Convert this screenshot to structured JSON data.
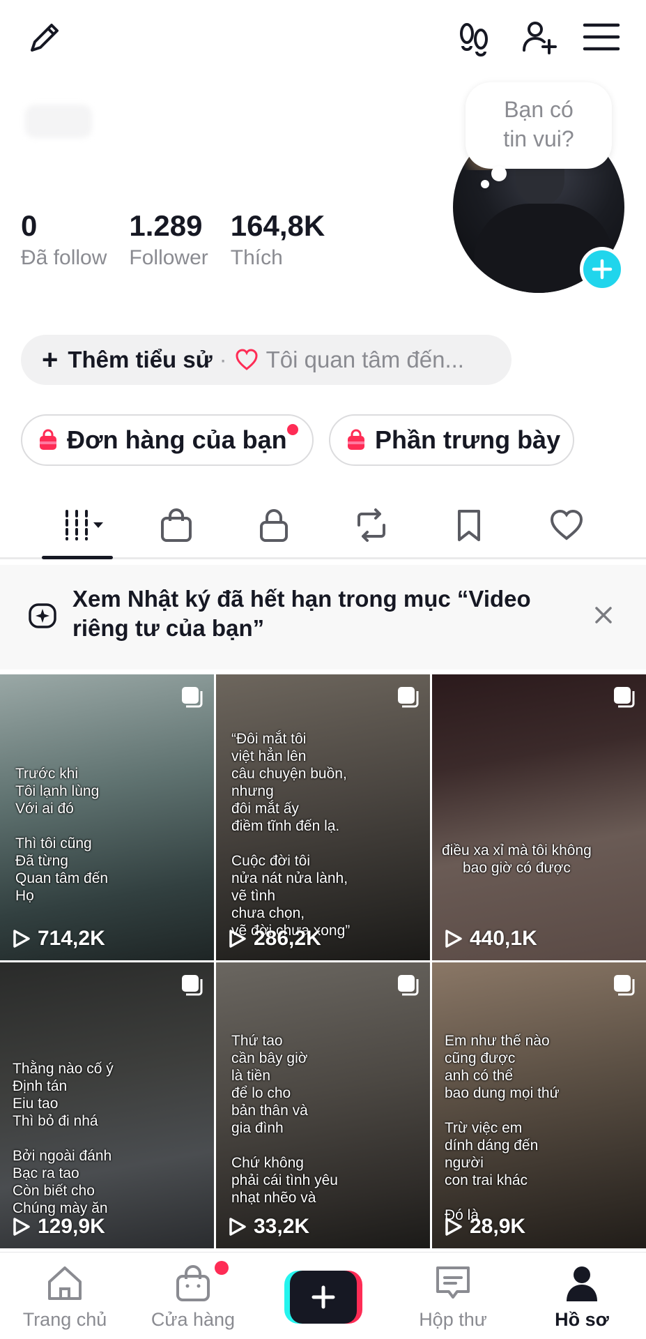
{
  "stats": [
    {
      "value": "0",
      "label": "Đã follow"
    },
    {
      "value": "1.289",
      "label": "Follower"
    },
    {
      "value": "164,8K",
      "label": "Thích"
    }
  ],
  "bubble": {
    "line1": "Bạn có",
    "line2": "tin vui?"
  },
  "bio": {
    "add_label": "Thêm tiểu sử",
    "separator": "·",
    "interest_label": "Tôi quan tâm đến..."
  },
  "pills": {
    "orders": "Đơn hàng của bạn",
    "showcase": "Phần trưng bày"
  },
  "banner": {
    "text": "Xem Nhật ký đã hết hạn trong mục “Video riêng tư của bạn”"
  },
  "videos": [
    {
      "caption": "Trước khi\nTôi lạnh lùng\nVới ai đó\n\nThì tôi cũng\nĐã từng\nQuan tâm đến\nHọ",
      "views": "714,2K"
    },
    {
      "caption": "“Đôi mắt tôi\nviệt hẳn lên\ncâu chuyện buồn,\nnhưng\nđôi mắt ấy\nđiềm tĩnh đến lạ.\n\nCuộc đời tôi\nnửa nát nửa lành,\nvẽ tình\nchưa chọn,\nvẽ đời chưa xong”",
      "views": "286,2K"
    },
    {
      "caption": "điều xa xỉ mà tôi không\nbao giờ có được",
      "views": "440,1K"
    },
    {
      "caption": "Thằng nào cố ý\nĐịnh tán\nEiu tao\nThì bỏ đi nhá\n\nBởi ngoài đánh\nBạc ra tao\nCòn biết cho\nChúng mày ăn",
      "views": "129,9K"
    },
    {
      "caption": "Thứ tao\ncần bây giờ\nlà tiền\nđể lo cho\nbản thân và\ngia đình\n\nChứ không\nphải cái tình yêu\nnhạt nhẽo và",
      "views": "33,2K"
    },
    {
      "caption": "Em như thế nào\ncũng được\nanh có thể\nbao dung mọi thứ\n\nTrừ việc em\ndính dáng đến\nngười\ncon trai khác\n\nĐó là",
      "views": "28,9K"
    }
  ],
  "nav": {
    "home": "Trang chủ",
    "shop": "Cửa hàng",
    "inbox": "Hộp thư",
    "profile": "Hồ sơ"
  },
  "colors": {
    "accent_cyan": "#20d5ec",
    "tiktok_red": "#fe2c55",
    "text": "#161823",
    "muted": "#8a8b91"
  }
}
